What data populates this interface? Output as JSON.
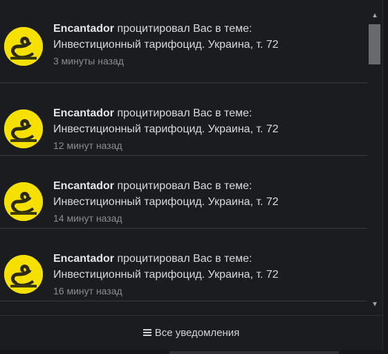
{
  "notifications": [
    {
      "user": "Encantador",
      "action": "процитировал Вас в теме:",
      "thread": "Инвестиционный тарифоцид. Украина, т. 72",
      "time": "3 минуты назад",
      "avatar_icon": "gadsden-flag-avatar"
    },
    {
      "user": "Encantador",
      "action": "процитировал Вас в теме:",
      "thread": "Инвестиционный тарифоцид. Украина, т. 72",
      "time": "12 минут назад",
      "avatar_icon": "gadsden-flag-avatar"
    },
    {
      "user": "Encantador",
      "action": "процитировал Вас в теме:",
      "thread": "Инвестиционный тарифоцид. Украина, т. 72",
      "time": "14 минут назад",
      "avatar_icon": "gadsden-flag-avatar"
    },
    {
      "user": "Encantador",
      "action": "процитировал Вас в теме:",
      "thread": "Инвестиционный тарифоцид. Украина, т. 72",
      "time": "16 минут назад",
      "avatar_icon": "gadsden-flag-avatar"
    }
  ],
  "footer": {
    "all_notifications_label": "Все уведомления",
    "icon": "list-icon"
  },
  "colors": {
    "background": "#1b1c20",
    "text": "#d9dadd",
    "muted": "#8b8d93",
    "avatar_yellow": "#f5e000"
  }
}
